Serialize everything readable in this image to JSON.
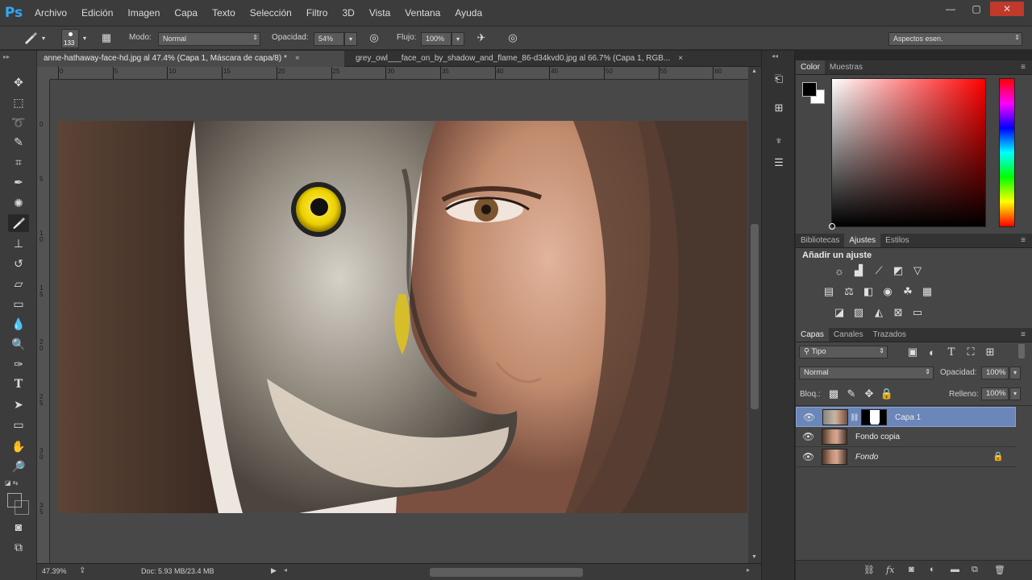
{
  "app": {
    "logo": "Ps"
  },
  "menu": [
    "Archivo",
    "Edición",
    "Imagen",
    "Capa",
    "Texto",
    "Selección",
    "Filtro",
    "3D",
    "Vista",
    "Ventana",
    "Ayuda"
  ],
  "window_controls": {
    "minimize": "—",
    "maximize": "▢",
    "close": "✕"
  },
  "options_bar": {
    "brush_size": "133",
    "mode_label": "Modo:",
    "mode_value": "Normal",
    "opacity_label": "Opacidad:",
    "opacity_value": "54%",
    "flow_label": "Flujo:",
    "flow_value": "100%",
    "workspace_value": "Aspectos esen."
  },
  "document_tabs": [
    {
      "label": "anne-hathaway-face-hd.jpg al 47.4% (Capa 1, Máscara de capa/8) *",
      "active": true
    },
    {
      "label": "grey_owl___face_on_by_shadow_and_flame_86-d34kvd0.jpg al 66.7% (Capa 1, RGB...",
      "active": false
    }
  ],
  "tab_close_glyph": "×",
  "ruler_h": [
    "0",
    "5",
    "10",
    "15",
    "20",
    "25",
    "30",
    "35",
    "40",
    "45",
    "50",
    "55",
    "60"
  ],
  "ruler_v": [
    "0",
    "5",
    "1 0",
    "1 5",
    "2 0",
    "2 5",
    "3 0",
    "3 5"
  ],
  "status_bar": {
    "zoom": "47.39%",
    "doc": "Doc: 5.93 MB/23.4 MB"
  },
  "color_panel": {
    "tabs": [
      "Color",
      "Muestras"
    ],
    "foreground": "#000000",
    "background": "#ffffff",
    "hue": "#ff0000"
  },
  "adjustments_panel": {
    "tabs": [
      "Bibliotecas",
      "Ajustes",
      "Estilos"
    ],
    "active_tab": "Ajustes",
    "title": "Añadir un ajuste",
    "row1": [
      "brightness-icon",
      "levels-icon",
      "curves-icon",
      "exposure-icon",
      "vibrance-icon"
    ],
    "row2": [
      "hue-saturation-icon",
      "color-balance-icon",
      "black-white-icon",
      "photo-filter-icon",
      "channel-mixer-icon",
      "color-lookup-icon"
    ],
    "row3": [
      "invert-icon",
      "posterize-icon",
      "threshold-icon",
      "selective-color-icon",
      "gradient-map-icon"
    ]
  },
  "layers_panel": {
    "tabs": [
      "Capas",
      "Canales",
      "Trazados"
    ],
    "filter_kind": "Tipo",
    "blend_mode": "Normal",
    "opacity_label": "Opacidad:",
    "opacity_value": "100%",
    "lock_label": "Bloq.:",
    "fill_label": "Relleno:",
    "fill_value": "100%",
    "layers": [
      {
        "name": "Capa 1",
        "selected": true,
        "italic": false,
        "locked": false,
        "has_mask": true
      },
      {
        "name": "Fondo copia",
        "selected": false,
        "italic": false,
        "locked": false,
        "has_mask": false
      },
      {
        "name": "Fondo",
        "selected": false,
        "italic": true,
        "locked": true,
        "has_mask": false
      }
    ],
    "bottom_icons": [
      "link-icon",
      "fx-icon",
      "add-mask-icon",
      "adjustment-layer-icon",
      "group-folder-icon",
      "new-layer-icon",
      "trash-icon"
    ]
  }
}
